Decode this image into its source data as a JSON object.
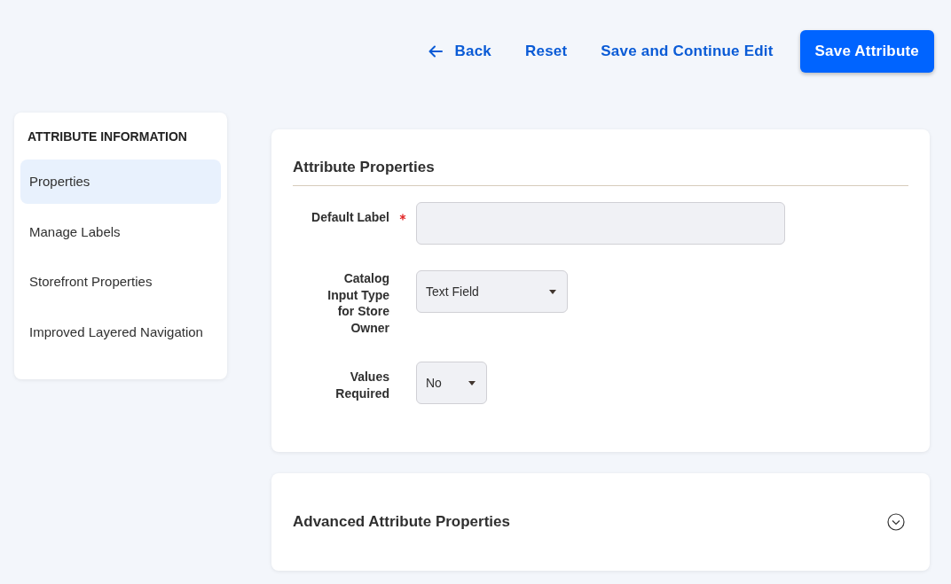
{
  "actions": [
    {
      "kind": "back",
      "label": "Back"
    },
    {
      "kind": "link",
      "label": "Reset"
    },
    {
      "kind": "link",
      "label": "Save and Continue Edit"
    },
    {
      "kind": "primary",
      "label": "Save Attribute"
    }
  ],
  "sidebar": {
    "title": "ATTRIBUTE INFORMATION",
    "items": [
      {
        "label": "Properties",
        "selected": true
      },
      {
        "label": "Manage Labels",
        "selected": false
      },
      {
        "label": "Storefront Properties",
        "selected": false
      },
      {
        "label": "Improved Layered Navigation",
        "selected": false
      }
    ]
  },
  "attribute_properties": {
    "title": "Attribute Properties",
    "fields": [
      {
        "kind": "text",
        "label": "Default Label",
        "required": true
      },
      {
        "kind": "select",
        "label": "Catalog Input Type for Store Owner",
        "required": false,
        "value": "Text Field"
      },
      {
        "kind": "select",
        "label": "Values Required",
        "required": false,
        "value": "No"
      }
    ]
  },
  "advanced": {
    "title": "Advanced Attribute Properties",
    "expanded": false
  }
}
